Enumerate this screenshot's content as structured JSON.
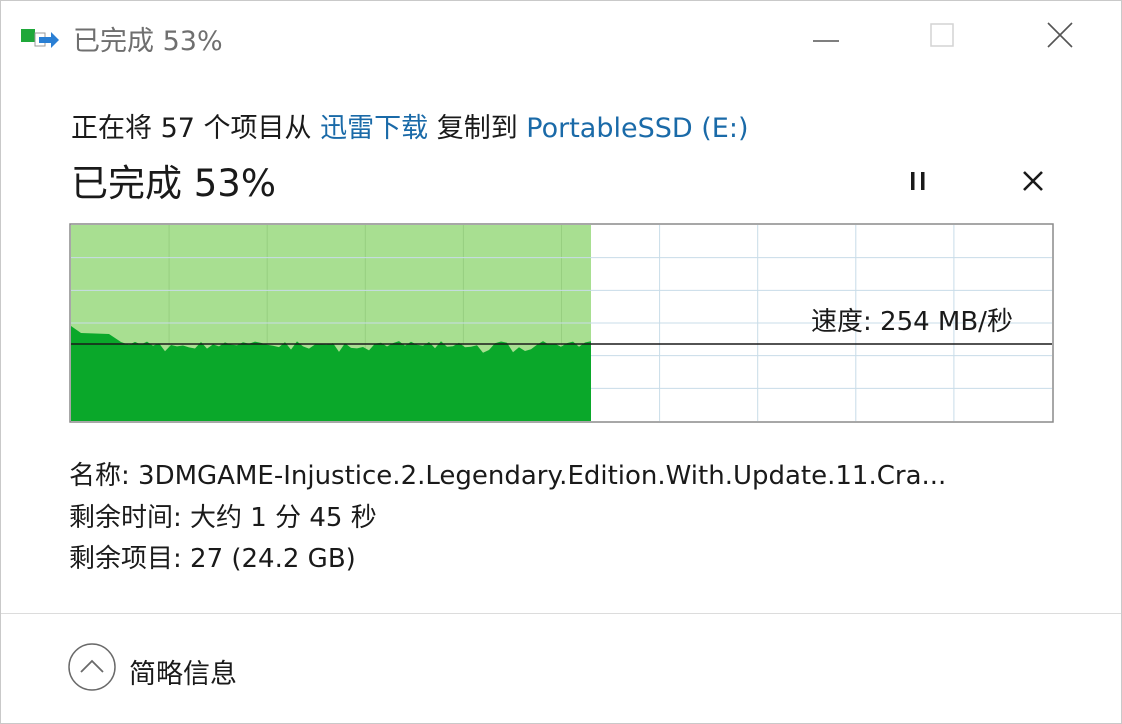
{
  "window": {
    "title": "已完成 53%"
  },
  "copy": {
    "prefix": "正在将 57 个项目从 ",
    "source": "迅雷下载",
    "middle": " 复制到 ",
    "destination": "PortableSSD (E:)",
    "status": "已完成 53%",
    "progress_fraction": 0.53
  },
  "speed": {
    "label": "速度: 254 MB/秒"
  },
  "details": {
    "name": "名称:  3DMGAME-Injustice.2.Legendary.Edition.With.Update.11.Cra...",
    "time_remaining": "剩余时间:  大约 1 分 45 秒",
    "items_remaining": "剩余项目:  27 (24.2 GB)"
  },
  "footer": {
    "toggle_label": "简略信息"
  },
  "colors": {
    "progress_fill": "#a8df91",
    "speed_fill": "#0aa82a",
    "grid_line": "#c8dce8",
    "link": "#1a6aa8"
  },
  "icons": {
    "app": "file-copy-icon",
    "minimize": "minimize-icon",
    "maximize": "maximize-icon",
    "close": "close-icon",
    "pause": "pause-icon",
    "cancel": "cancel-icon",
    "collapse": "chevron-up-icon"
  }
}
